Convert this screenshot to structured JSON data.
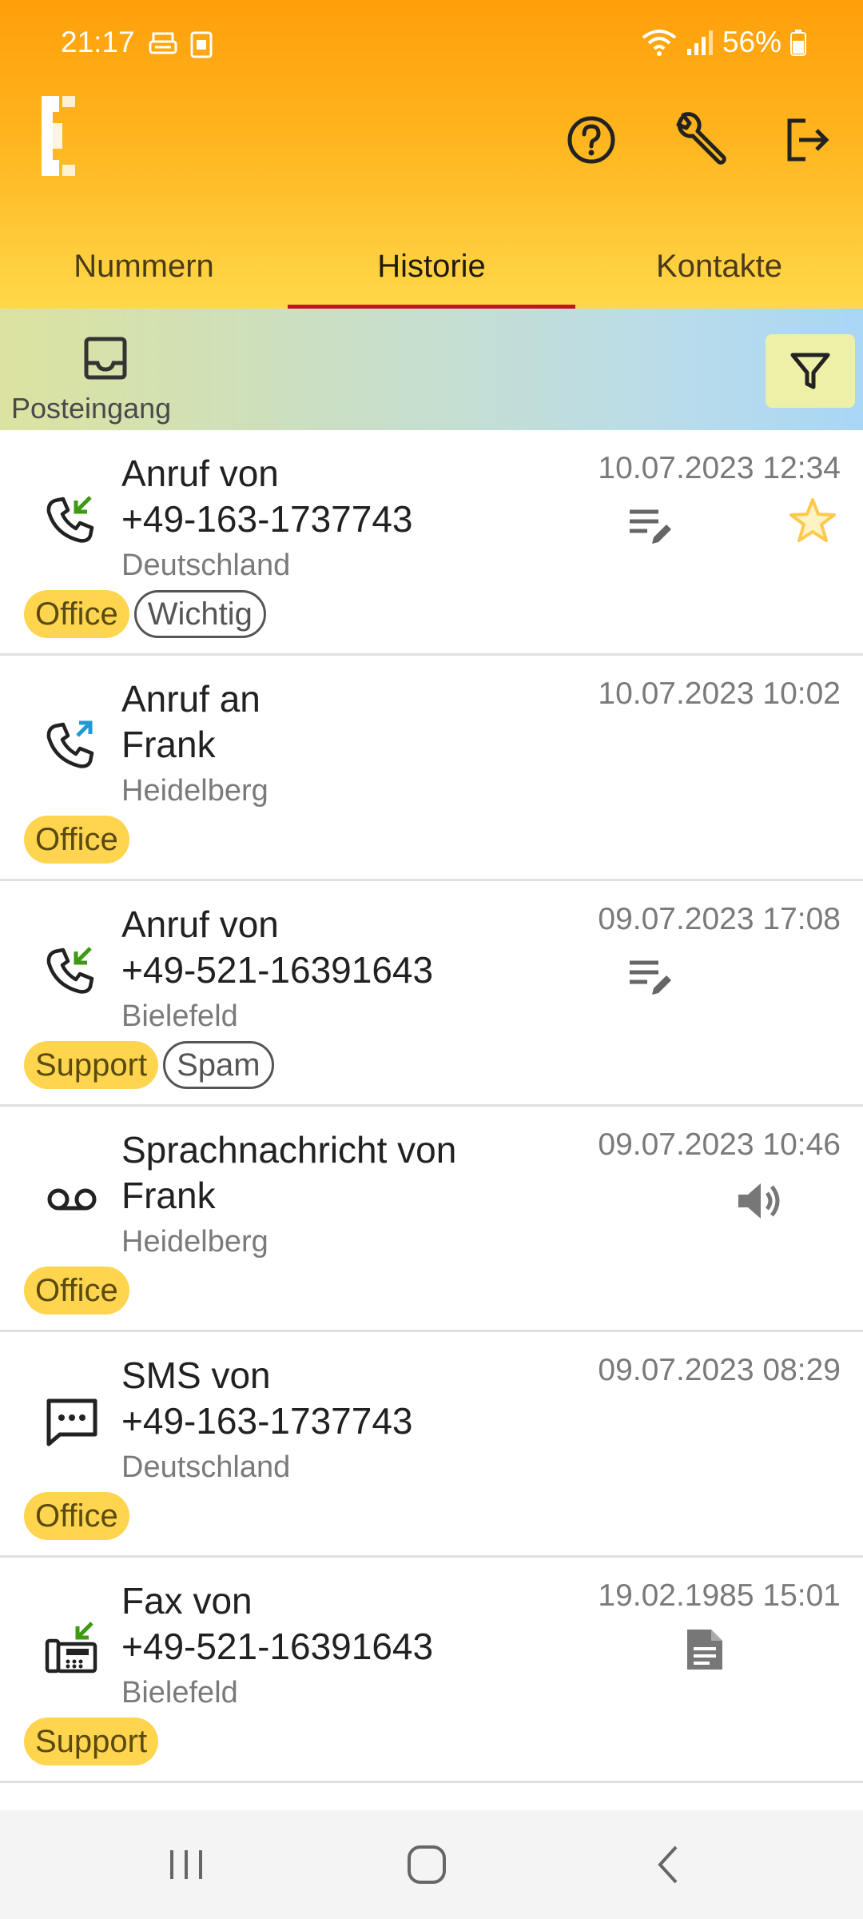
{
  "status": {
    "time": "21:17",
    "battery": "56%"
  },
  "tabs": [
    {
      "label": "Nummern"
    },
    {
      "label": "Historie"
    },
    {
      "label": "Kontakte"
    }
  ],
  "filter": {
    "inbox_label": "Posteingang"
  },
  "items": [
    {
      "icon": "incoming-call-icon",
      "line1": "Anruf von",
      "line2": "+49-163-1737743",
      "location": "Deutschland",
      "date": "10.07.2023 12:34",
      "tags": [
        {
          "label": "Office",
          "style": "filled"
        },
        {
          "label": "Wichtig",
          "style": "outline"
        }
      ],
      "has_note": true,
      "starred": true
    },
    {
      "icon": "outgoing-call-icon",
      "line1": "Anruf an",
      "line2": "Frank",
      "location": "Heidelberg",
      "date": "10.07.2023 10:02",
      "tags": [
        {
          "label": "Office",
          "style": "filled"
        }
      ]
    },
    {
      "icon": "incoming-call-icon",
      "line1": "Anruf von",
      "line2": "+49-521-16391643",
      "location": "Bielefeld",
      "date": "09.07.2023 17:08",
      "tags": [
        {
          "label": "Support",
          "style": "filled"
        },
        {
          "label": "Spam",
          "style": "outline"
        }
      ],
      "has_note": true
    },
    {
      "icon": "voicemail-icon",
      "line1": "Sprachnachricht von",
      "line2": "Frank",
      "location": "Heidelberg",
      "date": "09.07.2023 10:46",
      "tags": [
        {
          "label": "Office",
          "style": "filled"
        }
      ],
      "has_audio": true
    },
    {
      "icon": "sms-icon",
      "line1": "SMS von",
      "line2": "+49-163-1737743",
      "location": "Deutschland",
      "date": "09.07.2023 08:29",
      "tags": [
        {
          "label": "Office",
          "style": "filled"
        }
      ]
    },
    {
      "icon": "fax-icon",
      "line1": "Fax von",
      "line2": "+49-521-16391643",
      "location": "Bielefeld",
      "date": "19.02.1985 15:01",
      "tags": [
        {
          "label": "Support",
          "style": "filled"
        }
      ],
      "has_document": true
    }
  ],
  "colors": {
    "header_top": "#FF9F0A",
    "header_bottom": "#FFD84A",
    "tab_indicator": "#C2161B",
    "tag_fill": "#FFD54F",
    "incoming_arrow": "#3E9A12",
    "outgoing_arrow": "#1E9BD7",
    "star": "#FFC94D"
  }
}
